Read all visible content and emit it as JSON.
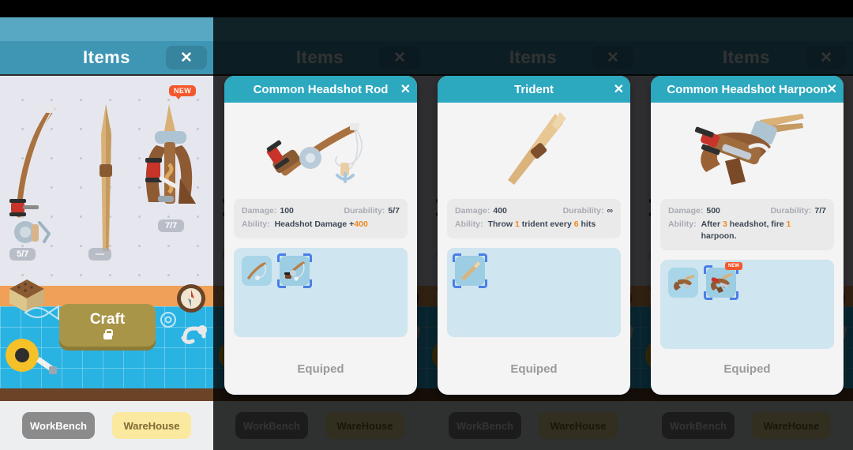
{
  "panel": {
    "title": "Items",
    "close_label": "✕",
    "craft_label": "Craft",
    "craft_locked": true,
    "rod_durability": "5/7",
    "spear_durability": "—",
    "harpoon_durability": "7/7",
    "new_badge": "NEW",
    "buttons": {
      "workbench": "WorkBench",
      "warehouse": "WareHouse"
    }
  },
  "cards": [
    {
      "title": "Common Headshot Rod",
      "close_label": "✕",
      "damage_label": "Damage:",
      "damage_value": "100",
      "durability_label": "Durability:",
      "durability_value": "5/7",
      "ability_label": "Ability:",
      "ability_pre": "Headshot Damage +",
      "ability_highlight": "400",
      "ability_post": "",
      "footer": "Equiped",
      "slots": [
        {
          "selected": false,
          "new": false,
          "icon": "fishing-rod-plain"
        },
        {
          "selected": true,
          "new": false,
          "icon": "fishing-rod-reel"
        }
      ]
    },
    {
      "title": "Trident",
      "close_label": "✕",
      "damage_label": "Damage:",
      "damage_value": "400",
      "durability_label": "Durability:",
      "durability_value": "∞",
      "ability_label": "Ability:",
      "ability_pre": "Throw ",
      "ability_highlight": "1",
      "ability_post": " trident every ",
      "ability_highlight2": "6",
      "ability_post2": " hits",
      "footer": "Equiped",
      "slots": [
        {
          "selected": true,
          "new": false,
          "icon": "trident"
        }
      ]
    },
    {
      "title": "Common Headshot Harpoon",
      "close_label": "✕",
      "damage_label": "Damage:",
      "damage_value": "500",
      "durability_label": "Durability:",
      "durability_value": "7/7",
      "ability_label": "Ability:",
      "ability_pre": "After ",
      "ability_highlight": "3",
      "ability_post": " headshot, fire ",
      "ability_highlight2": "1",
      "ability_post2": " harpoon.",
      "footer": "Equiped",
      "slots": [
        {
          "selected": false,
          "new": false,
          "icon": "harpoon-small"
        },
        {
          "selected": true,
          "new": true,
          "icon": "harpoon-gun",
          "new_label": "NEW"
        }
      ]
    }
  ],
  "colors": {
    "teal_header": "#2ca8bf",
    "panel_header": "#3f96b4",
    "panel_blue": "#58a8c4",
    "accent_orange": "#f08a1e",
    "new_badge": "#f4572c",
    "warehouse_yellow": "#fbe9a0",
    "workbench_gray": "#8b8b8b",
    "slot_blue": "#a8d5e8",
    "selection_blue": "#4a7fe8"
  }
}
